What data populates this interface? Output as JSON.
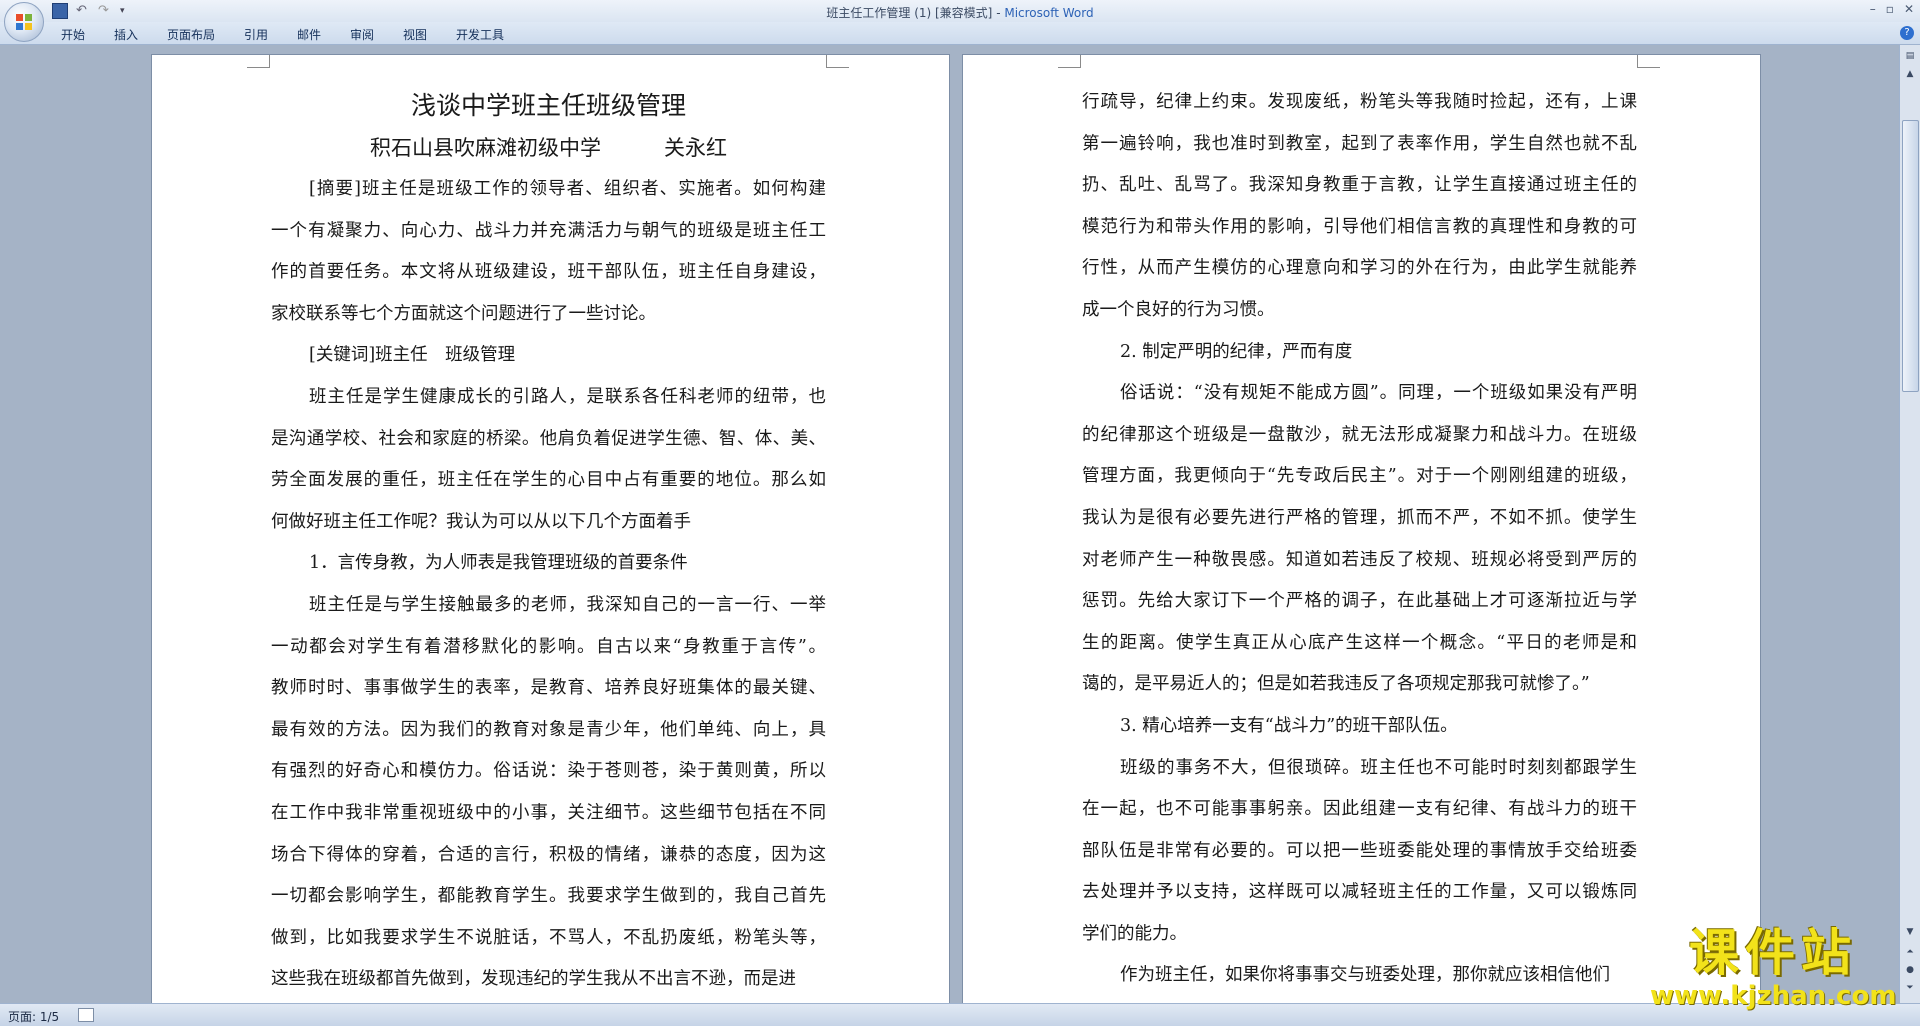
{
  "window": {
    "doc_name": "班主任工作管理 (1) [兼容模式]",
    "separator": " - ",
    "app_name": "Microsoft Word"
  },
  "ribbon": {
    "tabs": [
      "开始",
      "插入",
      "页面布局",
      "引用",
      "邮件",
      "审阅",
      "视图",
      "开发工具"
    ]
  },
  "status": {
    "page": "页面: 1/5"
  },
  "watermark": {
    "text": "课件站",
    "url": "www.kjzhan.com"
  },
  "document": {
    "title": "浅谈中学班主任班级管理",
    "author_line": "积石山县吹麻滩初级中学　　　关永红",
    "left_lines": [
      "[摘要]班主任是班级工作的领导者、组织者、实施者。如何构建",
      "一个有凝聚力、向心力、战斗力并充满活力与朝气的班级是班主任工",
      "作的首要任务。本文将从班级建设，班干部队伍，班主任自身建设，",
      "家校联系等七个方面就这个问题进行了一些讨论。",
      "[关键词]班主任　班级管理",
      "班主任是学生健康成长的引路人，是联系各任科老师的纽带，也",
      "是沟通学校、社会和家庭的桥梁。他肩负着促进学生德、智、体、美、",
      "劳全面发展的重任，班主任在学生的心目中占有重要的地位。那么如",
      "何做好班主任工作呢？我认为可以从以下几个方面着手",
      "1．言传身教，为人师表是我管理班级的首要条件",
      "班主任是与学生接触最多的老师，我深知自己的一言一行、一举",
      "一动都会对学生有着潜移默化的影响。自古以来“身教重于言传”。",
      "教师时时、事事做学生的表率，是教育、培养良好班集体的最关键、",
      "最有效的方法。因为我们的教育对象是青少年，他们单纯、向上，具",
      "有强烈的好奇心和模仿力。俗话说：染于苍则苍，染于黄则黄，所以",
      "在工作中我非常重视班级中的小事，关注细节。这些细节包括在不同",
      "场合下得体的穿着，合适的言行，积极的情绪，谦恭的态度，因为这",
      "一切都会影响学生，都能教育学生。我要求学生做到的，我自己首先",
      "做到，比如我要求学生不说脏话，不骂人，不乱扔废纸，粉笔头等，",
      "这些我在班级都首先做到，发现违纪的学生我从不出言不逊，而是进"
    ],
    "right_lines": [
      "行疏导，纪律上约束。发现废纸，粉笔头等我随时捡起，还有，上课",
      "第一遍铃响，我也准时到教室，起到了表率作用，学生自然也就不乱",
      "扔、乱吐、乱骂了。我深知身教重于言教，让学生直接通过班主任的",
      "模范行为和带头作用的影响，引导他们相信言教的真理性和身教的可",
      "行性，从而产生模仿的心理意向和学习的外在行为，由此学生就能养",
      "成一个良好的行为习惯。",
      "2. 制定严明的纪律，严而有度",
      "俗话说：“没有规矩不能成方圆”。同理，一个班级如果没有严明",
      "的纪律那这个班级是一盘散沙，就无法形成凝聚力和战斗力。在班级",
      "管理方面，我更倾向于“先专政后民主”。对于一个刚刚组建的班级，",
      "我认为是很有必要先进行严格的管理，抓而不严，不如不抓。使学生",
      "对老师产生一种敬畏感。知道如若违反了校规、班规必将受到严厉的",
      "惩罚。先给大家订下一个严格的调子，在此基础上才可逐渐拉近与学",
      "生的距离。使学生真正从心底产生这样一个概念。“平日的老师是和",
      "蔼的，是平易近人的；但是如若我违反了各项规定那我可就惨了。”",
      "3. 精心培养一支有“战斗力”的班干部队伍。",
      "班级的事务不大，但很琐碎。班主任也不可能时时刻刻都跟学生",
      "在一起，也不可能事事躬亲。因此组建一支有纪律、有战斗力的班干",
      "部队伍是非常有必要的。可以把一些班委能处理的事情放手交给班委",
      "去处理并予以支持，这样既可以减轻班主任的工作量，又可以锻炼同",
      "学们的能力。",
      "作为班主任，如果你将事事交与班委处理，那你就应该相信他们"
    ]
  }
}
